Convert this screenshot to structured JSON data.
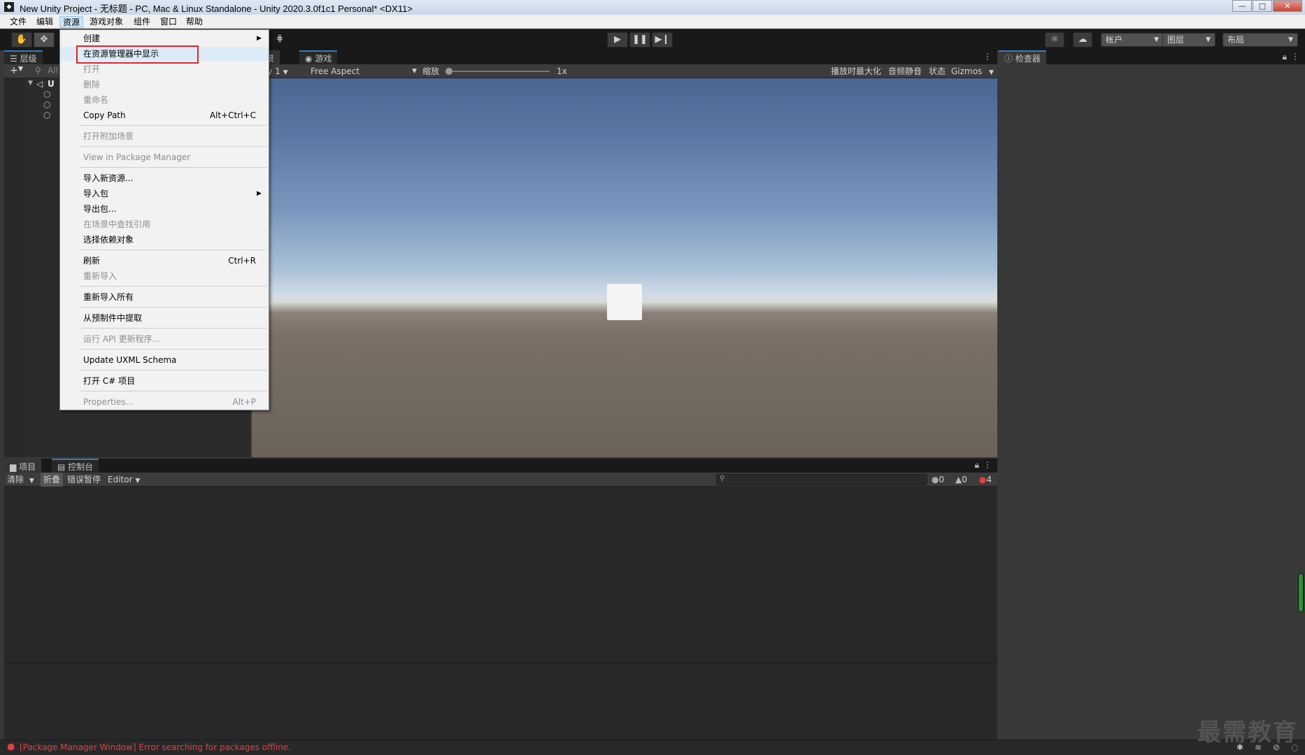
{
  "window": {
    "title": "New Unity Project - 无标题 - PC, Mac & Linux Standalone - Unity 2020.3.0f1c1 Personal* <DX11>",
    "controls": {
      "minimize": "—",
      "maximize": "□",
      "close": "✕"
    }
  },
  "menubar": {
    "items": [
      {
        "label": "文件"
      },
      {
        "label": "编辑"
      },
      {
        "label": "资源"
      },
      {
        "label": "游戏对象"
      },
      {
        "label": "组件"
      },
      {
        "label": "窗口"
      },
      {
        "label": "帮助"
      }
    ]
  },
  "toolbar": {
    "account_label": "帐户",
    "layers_label": "图层",
    "layout_label": "布局"
  },
  "hierarchy": {
    "tab_label": "层级",
    "add_label": "+",
    "search_placeholder": "All",
    "scene_label": "U"
  },
  "game_view": {
    "scene_tab_label": "场景",
    "game_tab_label": "游戏",
    "display_label": "play 1",
    "aspect_label": "Free Aspect",
    "scale_label": "缩放",
    "scale_value": "1x",
    "maximize_label": "播放时最大化",
    "mute_label": "音频静音",
    "stats_label": "状态",
    "gizmos_label": "Gizmos"
  },
  "inspector": {
    "tab_label": "检查器"
  },
  "context_menu": {
    "items": [
      {
        "label": "创建",
        "shortcut": "",
        "submenu": true,
        "disabled": false
      },
      {
        "label": "在资源管理器中显示",
        "shortcut": "",
        "submenu": false,
        "disabled": false
      },
      {
        "label": "打开",
        "shortcut": "",
        "submenu": false,
        "disabled": true
      },
      {
        "label": "删除",
        "shortcut": "",
        "submenu": false,
        "disabled": true
      },
      {
        "label": "重命名",
        "shortcut": "",
        "submenu": false,
        "disabled": true
      },
      {
        "label": "Copy Path",
        "shortcut": "Alt+Ctrl+C",
        "submenu": false,
        "disabled": false
      },
      {
        "label": "打开附加场景",
        "shortcut": "",
        "submenu": false,
        "disabled": true
      },
      {
        "label": "View in Package Manager",
        "shortcut": "",
        "submenu": false,
        "disabled": true
      },
      {
        "label": "导入新资源...",
        "shortcut": "",
        "submenu": false,
        "disabled": false
      },
      {
        "label": "导入包",
        "shortcut": "",
        "submenu": true,
        "disabled": false
      },
      {
        "label": "导出包...",
        "shortcut": "",
        "submenu": false,
        "disabled": false
      },
      {
        "label": "在场景中查找引用",
        "shortcut": "",
        "submenu": false,
        "disabled": true
      },
      {
        "label": "选择依赖对象",
        "shortcut": "",
        "submenu": false,
        "disabled": false
      },
      {
        "label": "刷新",
        "shortcut": "Ctrl+R",
        "submenu": false,
        "disabled": false
      },
      {
        "label": "重新导入",
        "shortcut": "",
        "submenu": false,
        "disabled": true
      },
      {
        "label": "重新导入所有",
        "shortcut": "",
        "submenu": false,
        "disabled": false
      },
      {
        "label": "从预制件中提取",
        "shortcut": "",
        "submenu": false,
        "disabled": false
      },
      {
        "label": "运行 API 更新程序...",
        "shortcut": "",
        "submenu": false,
        "disabled": true
      },
      {
        "label": "Update UXML Schema",
        "shortcut": "",
        "submenu": false,
        "disabled": false
      },
      {
        "label": "打开 C# 项目",
        "shortcut": "",
        "submenu": false,
        "disabled": false
      },
      {
        "label": "Properties...",
        "shortcut": "Alt+P",
        "submenu": false,
        "disabled": true
      }
    ]
  },
  "bottom_panel": {
    "project_tab_label": "项目",
    "console_tab_label": "控制台",
    "clear_label": "清除",
    "collapse_label": "折叠",
    "error_pause_label": "错误暂停",
    "editor_label": "Editor",
    "info_count": "0",
    "warning_count": "0",
    "error_count": "4"
  },
  "status_bar": {
    "message": "[Package Manager Window] Error searching for packages offline."
  },
  "watermark": "最需教育",
  "colors": {
    "accent": "#3a79bb",
    "highlight_box": "#e0232b",
    "error": "#d64545"
  }
}
